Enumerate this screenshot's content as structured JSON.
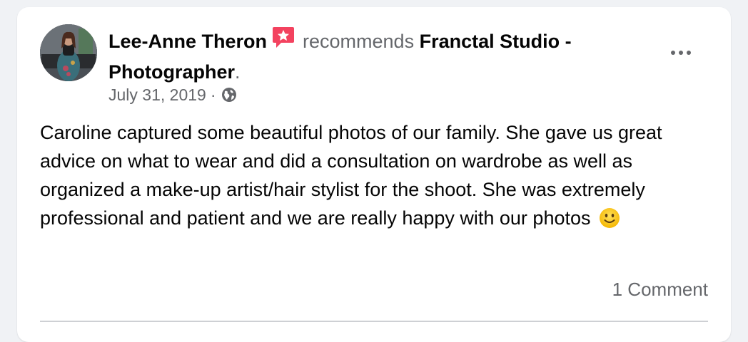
{
  "post": {
    "author": "Lee-Anne Theron",
    "action": "recommends",
    "page_name": "Franctal Studio - Photographer",
    "period": ".",
    "date": "July 31, 2019",
    "separator": "·",
    "privacy_icon": "globe-icon",
    "body": "Caroline captured some beautiful photos of our family. She gave us great advice on what to wear and did a consultation on wardrobe as well as organized a make-up artist/hair stylist for the shoot. She was extremely professional and patient and we are really happy with our photos",
    "emoji": "slightly-smiling-face-icon",
    "comments_label": "1 Comment"
  },
  "colors": {
    "recommend_badge": "#f3425f",
    "secondary_text": "#65676b",
    "primary_text": "#050505",
    "card_background": "#ffffff"
  }
}
